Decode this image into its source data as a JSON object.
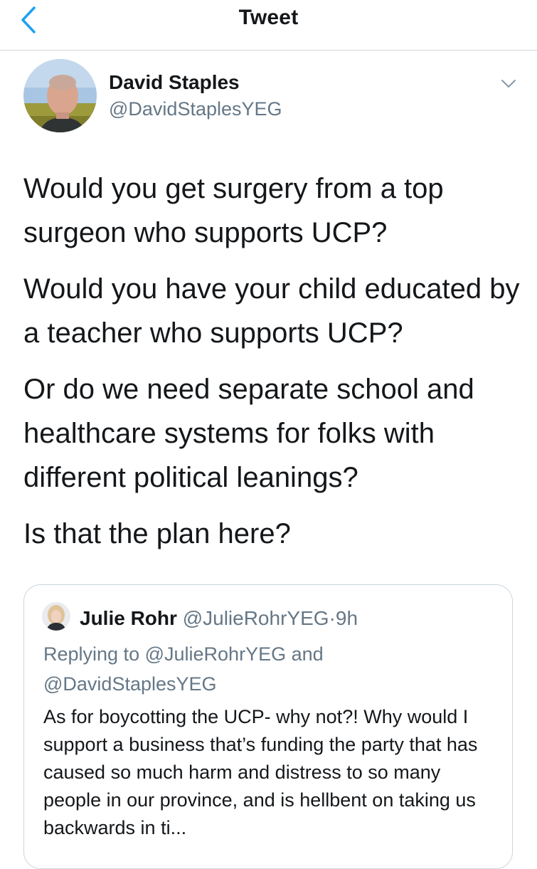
{
  "navbar": {
    "title": "Tweet",
    "back_icon": "chevron-left-icon",
    "accent_color": "#1da1f2"
  },
  "tweet": {
    "author": {
      "name": "David Staples",
      "handle": "@DavidStaplesYEG"
    },
    "menu_icon": "chevron-down-icon",
    "paragraphs": [
      "Would you get surgery from a top surgeon who supports UCP?",
      "Would you have your child educated by a teacher who supports UCP?",
      "Or do we need separate school and healthcare systems for folks with different political leanings?",
      "Is that the plan here?"
    ]
  },
  "quoted": {
    "name": "Julie Rohr",
    "handle": "@JulieRohrYEG",
    "separator": "·",
    "time": "9h",
    "reply_prefix": "Replying to",
    "reply_to": "@JulieRohrYEG",
    "reply_joiner": "and",
    "reply_to_2": "@DavidStaplesYEG",
    "text": "As for boycotting the UCP- why not?! Why would I support a business that’s funding the party that has caused so much harm and distress to so many people in our province, and is hellbent on taking us backwards in ti..."
  }
}
